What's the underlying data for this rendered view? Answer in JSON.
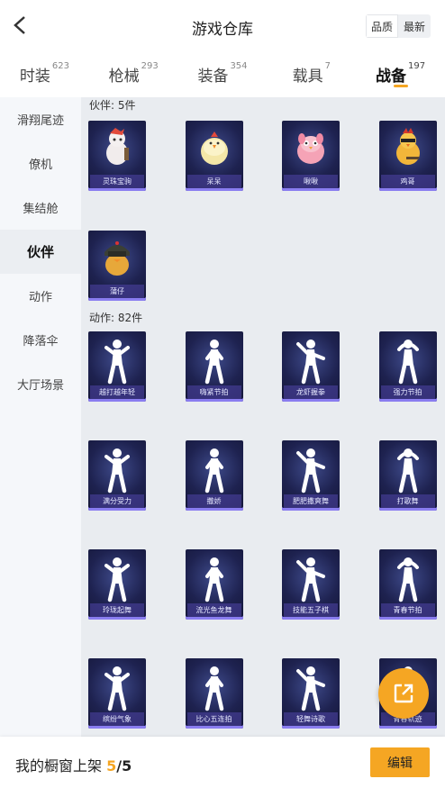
{
  "header": {
    "title": "游戏仓库",
    "sort_quality": "品质",
    "sort_latest": "最新"
  },
  "tabs": [
    {
      "label": "时装",
      "count": "623"
    },
    {
      "label": "枪械",
      "count": "293"
    },
    {
      "label": "装备",
      "count": "354"
    },
    {
      "label": "载具",
      "count": "7"
    },
    {
      "label": "战备",
      "count": "197"
    }
  ],
  "active_tab": "战备",
  "sidebar": [
    {
      "label": "滑翔尾迹"
    },
    {
      "label": "僚机"
    },
    {
      "label": "集结舱"
    },
    {
      "label": "伙伴"
    },
    {
      "label": "动作"
    },
    {
      "label": "降落伞"
    },
    {
      "label": "大厅场景"
    }
  ],
  "active_side": "伙伴",
  "partners": {
    "title": "伙伴: 5件",
    "items": [
      {
        "name": "灵珠宝驹",
        "icon": "horse-companion-icon"
      },
      {
        "name": "呆呆",
        "icon": "chick-companion-icon"
      },
      {
        "name": "啾啾",
        "icon": "pink-bird-companion-icon"
      },
      {
        "name": "鸡哥",
        "icon": "rooster-companion-icon"
      },
      {
        "name": "蒲仔",
        "icon": "helmet-duck-companion-icon"
      }
    ]
  },
  "actions": {
    "title": "动作: 82件",
    "items": [
      {
        "name": "越打越年轻"
      },
      {
        "name": "嗨紧节拍"
      },
      {
        "name": "龙虾握拳"
      },
      {
        "name": "强力节拍"
      },
      {
        "name": "满分受力"
      },
      {
        "name": "撒娇"
      },
      {
        "name": "肥肥撒爽舞"
      },
      {
        "name": "打歌舞"
      },
      {
        "name": "玲珑起舞"
      },
      {
        "name": "流光鱼龙舞"
      },
      {
        "name": "技能五子棋"
      },
      {
        "name": "青春节拍"
      },
      {
        "name": "缤纷气象"
      },
      {
        "name": "比心五连拍"
      },
      {
        "name": "轻舞诗歌"
      },
      {
        "name": "青春轨迹"
      }
    ]
  },
  "bottom": {
    "text": "我的橱窗上架",
    "current": "5",
    "total": "/5",
    "edit_label": "编辑"
  },
  "colors": {
    "accent": "#f5a623",
    "card_bg": "#1e2250",
    "card_stripe": "#8a7df0"
  }
}
